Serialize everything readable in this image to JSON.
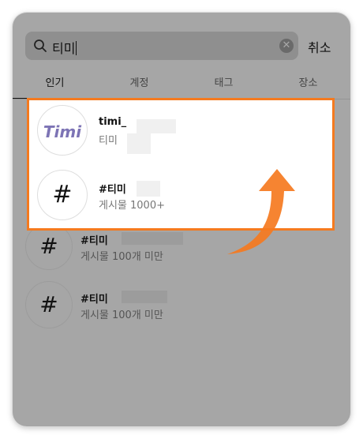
{
  "search": {
    "query": "티미",
    "cancel_label": "취소"
  },
  "tabs": [
    {
      "label": "인기"
    },
    {
      "label": "계정"
    },
    {
      "label": "태그"
    },
    {
      "label": "장소"
    }
  ],
  "highlighted": [
    {
      "title": "timi_",
      "subtitle": "티미",
      "avatar_text": "Timi"
    },
    {
      "title": "#티미",
      "subtitle": "게시물 1000+",
      "avatar_text": "#"
    }
  ],
  "results": [
    {
      "title": "#티미",
      "subtitle": "게시물 100개 미만",
      "avatar_text": "#"
    },
    {
      "title": "#티미",
      "subtitle": "게시물 100개 미만",
      "avatar_text": "#"
    }
  ],
  "colors": {
    "highlight_border": "#f57a1f",
    "arrow": "#f57a1f",
    "overlay": "#a6a6a6"
  }
}
